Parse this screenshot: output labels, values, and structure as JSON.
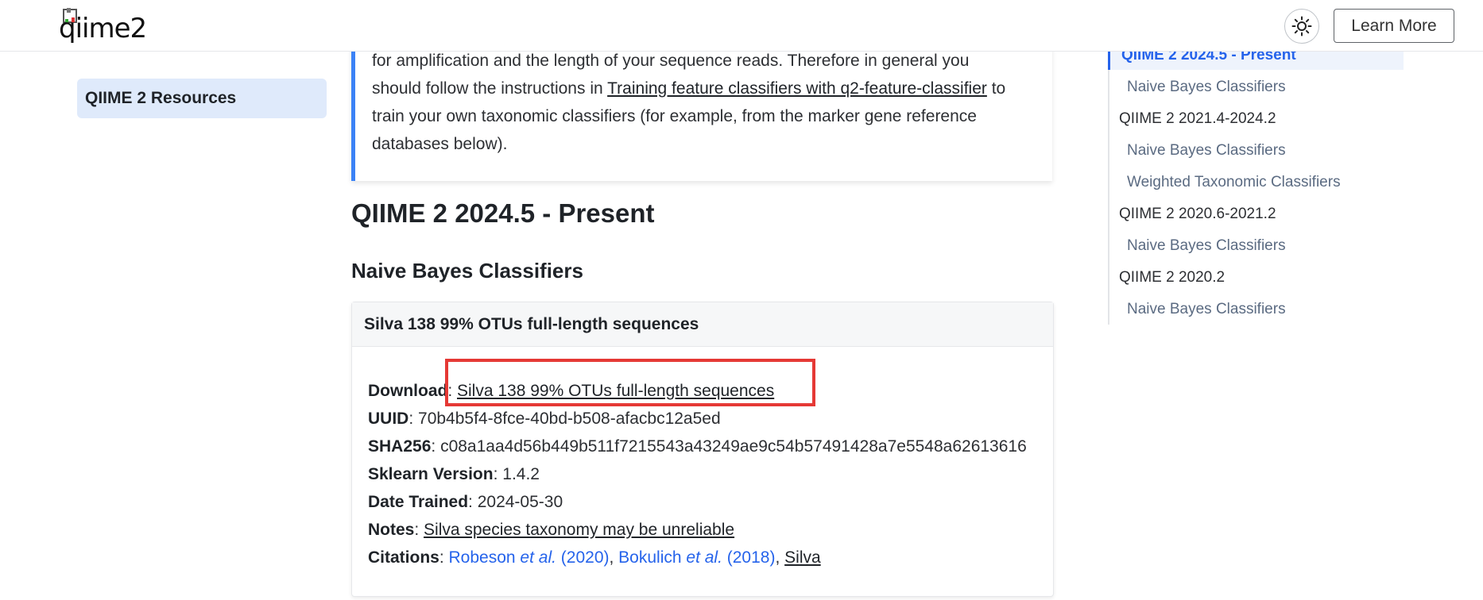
{
  "header": {
    "logo_text": "qiime2",
    "theme_icon": "sun-icon",
    "learn_more_label": "Learn More"
  },
  "sidebar": {
    "items": [
      {
        "label": "QIIME 2 Resources"
      }
    ]
  },
  "note": {
    "line1": "for amplification and the length of your sequence reads. Therefore in general you",
    "line2_pre": "should follow the instructions in ",
    "line2_link": "Training feature classifiers with q2-feature-classifier",
    "line2_post": " to",
    "line3": "train your own taxonomic classifiers (for example, from the marker gene reference",
    "line4": "databases below)."
  },
  "main": {
    "section_title": "QIIME 2 2024.5 - Present",
    "subsection_title": "Naive Bayes Classifiers",
    "card": {
      "title": "Silva 138 99% OTUs full-length sequences",
      "download_label": "Download",
      "download_link": "Silva 138 99% OTUs full-length sequences",
      "uuid_label": "UUID",
      "uuid_value": "70b4b5f4-8fce-40bd-b508-afacbc12a5ed",
      "sha_label": "SHA256",
      "sha_value": "c08a1aa4d56b449b511f7215543a43249ae9c54b57491428a7e5548a62613616",
      "sklearn_label": "Sklearn Version",
      "sklearn_value": "1.4.2",
      "date_label": "Date Trained",
      "date_value": "2024-05-30",
      "notes_label": "Notes",
      "notes_link": "Silva species taxonomy may be unreliable",
      "citations_label": "Citations",
      "cite1_author": "Robeson ",
      "cite1_etal": "et al.",
      "cite1_year": " (2020)",
      "cite2_author": "Bokulich ",
      "cite2_etal": "et al.",
      "cite2_year": " (2018)",
      "cite3": "Silva"
    }
  },
  "toc": {
    "items": [
      {
        "label": "QIIME 2 2024.5 - Present",
        "level": 1,
        "active": true
      },
      {
        "label": "Naive Bayes Classifiers",
        "level": 2
      },
      {
        "label": "QIIME 2 2021.4-2024.2",
        "level": 1
      },
      {
        "label": "Naive Bayes Classifiers",
        "level": 2
      },
      {
        "label": "Weighted Taxonomic Classifiers",
        "level": 2
      },
      {
        "label": "QIIME 2 2020.6-2021.2",
        "level": 1
      },
      {
        "label": "Naive Bayes Classifiers",
        "level": 2
      },
      {
        "label": "QIIME 2 2020.2",
        "level": 1
      },
      {
        "label": "Naive Bayes Classifiers",
        "level": 2
      }
    ]
  },
  "colors": {
    "accent": "#2563eb",
    "note_border": "#3b82f6",
    "highlight_box": "#e53935",
    "sidebar_active_bg": "#dfeafb"
  }
}
